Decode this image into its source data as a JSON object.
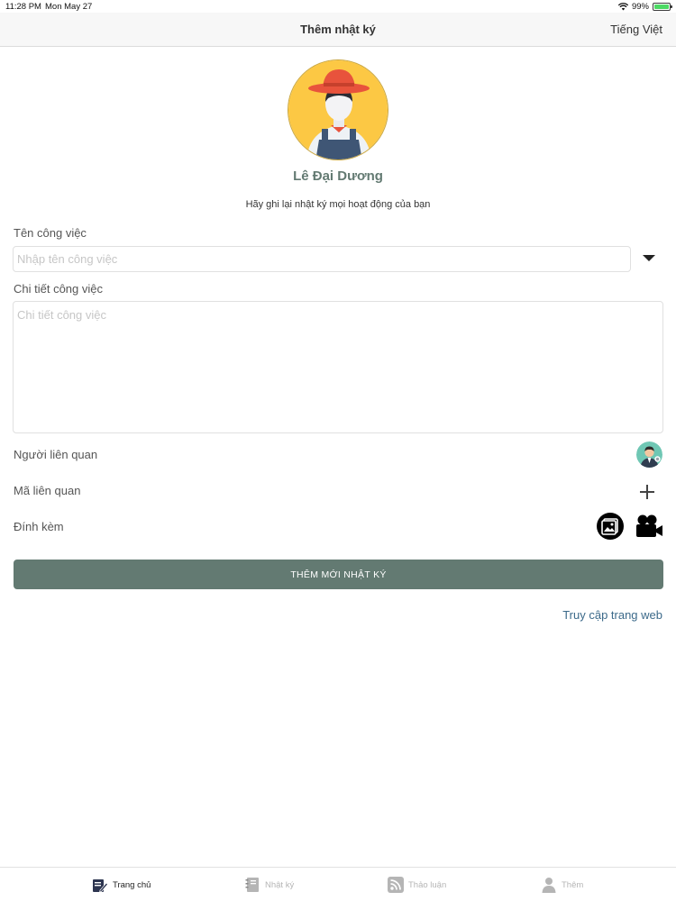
{
  "status_bar": {
    "time": "11:28 PM",
    "date": "Mon May 27",
    "battery": "99%"
  },
  "nav": {
    "title": "Thêm nhật ký",
    "language": "Tiếng Việt"
  },
  "profile": {
    "name": "Lê Đại Dương",
    "subtitle": "Hãy ghi lại nhật ký mọi hoạt động của bạn"
  },
  "form": {
    "task_name_label": "Tên công việc",
    "task_name_placeholder": "Nhập tên công việc",
    "task_detail_label": "Chi tiết công việc",
    "task_detail_placeholder": "Chi tiết công việc",
    "related_people_label": "Người liên quan",
    "related_code_label": "Mã liên quan",
    "attachment_label": "Đính kèm",
    "submit_label": "THÊM MỚI NHẬT KÝ",
    "web_link": "Truy cập trang web"
  },
  "tabs": [
    {
      "label": "Trang chủ",
      "icon": "home-edit-icon",
      "active": true
    },
    {
      "label": "Nhật ký",
      "icon": "notebook-icon",
      "active": false
    },
    {
      "label": "Thảo luận",
      "icon": "rss-icon",
      "active": false
    },
    {
      "label": "Thêm",
      "icon": "person-icon",
      "active": false
    }
  ],
  "colors": {
    "primary": "#637a72",
    "link": "#3c6a8a",
    "battery": "#4cd964",
    "avatar_bg": "#fcc844",
    "hat": "#e8533c"
  }
}
